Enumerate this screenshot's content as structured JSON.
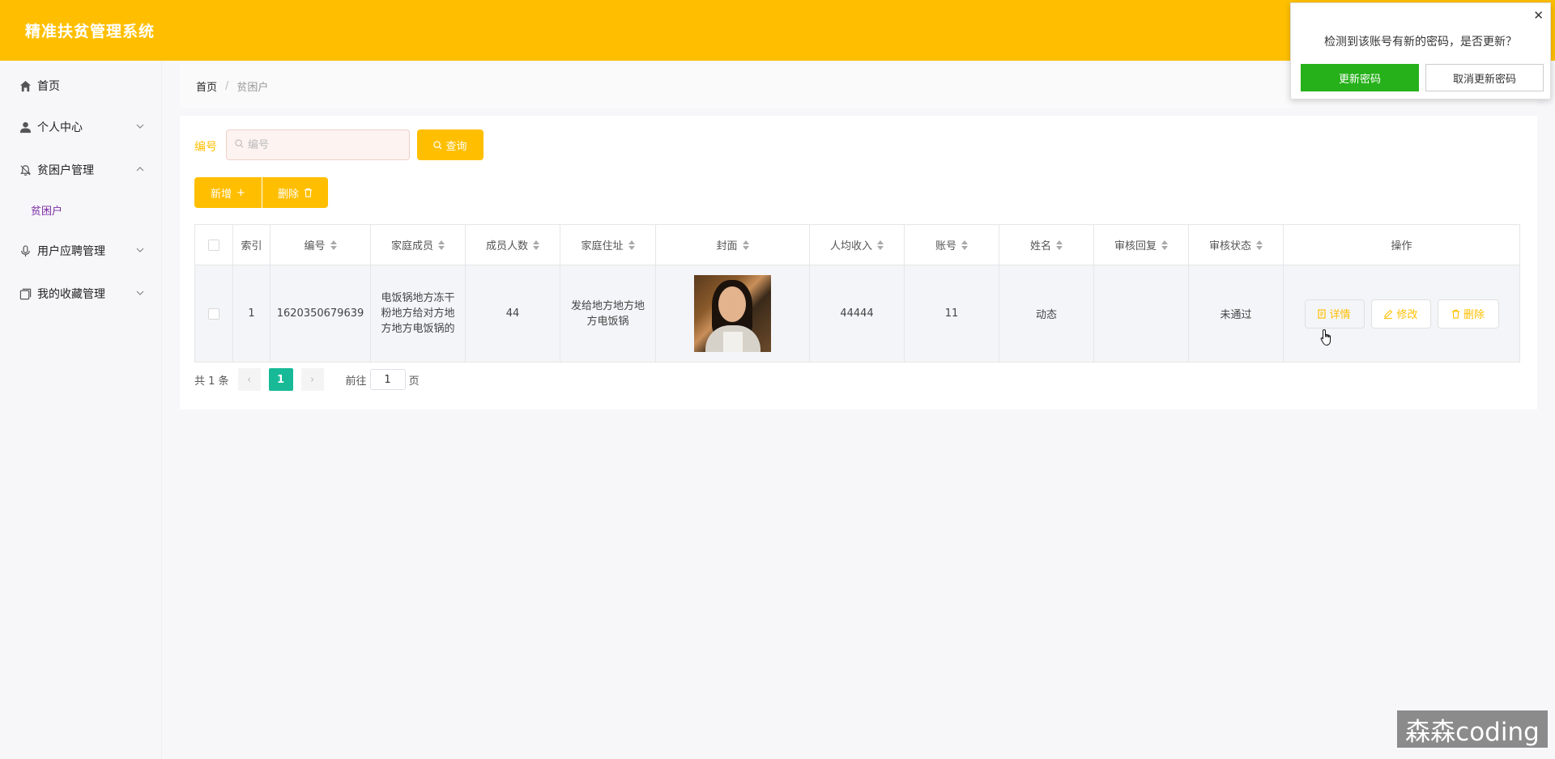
{
  "app": {
    "title": "精准扶贫管理系统"
  },
  "sidebar": {
    "items": [
      {
        "label": "首页",
        "icon": "home-icon"
      },
      {
        "label": "个人中心",
        "icon": "user-icon"
      },
      {
        "label": "贫困户管理",
        "icon": "bell-icon"
      },
      {
        "label": "用户应聘管理",
        "icon": "mic-icon"
      },
      {
        "label": "我的收藏管理",
        "icon": "collection-icon"
      }
    ],
    "sub_items": [
      {
        "label": "贫困户"
      }
    ]
  },
  "breadcrumb": {
    "home": "首页",
    "separator": "/",
    "current": "贫困户"
  },
  "search": {
    "label": "编号",
    "placeholder": "编号",
    "query_button": "查询"
  },
  "actions": {
    "add_label": "新增",
    "delete_label": "删除"
  },
  "table": {
    "columns": [
      "索引",
      "编号",
      "家庭成员",
      "成员人数",
      "家庭住址",
      "封面",
      "人均收入",
      "账号",
      "姓名",
      "审核回复",
      "审核状态",
      "操作"
    ],
    "rows": [
      {
        "index": "1",
        "code": "1620350679639",
        "members": "电饭锅地方冻干粉地方给对方地方地方电饭锅的",
        "member_count": "44",
        "address": "发给地方地方地方电饭锅",
        "income": "44444",
        "account": "11",
        "name": "动态",
        "review_reply": "",
        "review_status": "未通过"
      }
    ],
    "row_actions": {
      "detail": "详情",
      "edit": "修改",
      "delete": "删除"
    }
  },
  "pagination": {
    "total_text": "共 1 条",
    "current_page": "1",
    "goto_label": "前往",
    "goto_value": "1",
    "page_suffix": "页"
  },
  "popup": {
    "message": "检测到该账号有新的密码，是否更新？",
    "update_button": "更新密码",
    "cancel_button": "取消更新密码",
    "close": "✕"
  },
  "watermark": "森森coding",
  "colors": {
    "accent": "#ffbf00",
    "page_active": "#18b997",
    "update_green": "#26b11a",
    "submenu_active": "#7b2ca3"
  }
}
